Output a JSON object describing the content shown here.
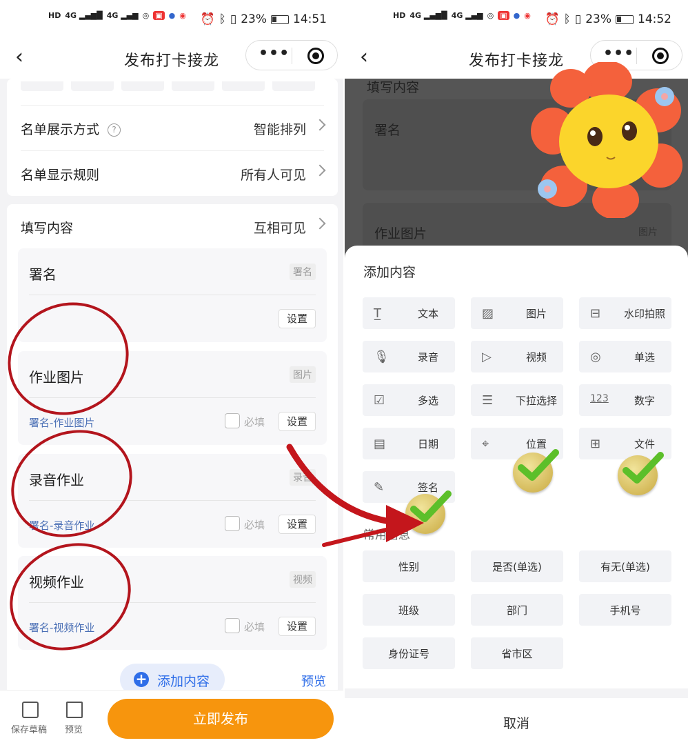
{
  "status_left": {
    "time": "14:51",
    "battery": "23%"
  },
  "status_right": {
    "time": "14:52",
    "battery": "23%"
  },
  "nav": {
    "title": "发布打卡接龙",
    "more": "•••"
  },
  "settings": {
    "display_mode": {
      "label": "名单展示方式",
      "value": "智能排列"
    },
    "display_rule": {
      "label": "名单显示规则",
      "value": "所有人可见"
    }
  },
  "fill": {
    "label": "填写内容",
    "value": "互相可见"
  },
  "items": [
    {
      "title": "署名",
      "tag": "署名",
      "setting": "设置"
    },
    {
      "title": "作业图片",
      "tag": "图片",
      "sub": "署名-作业图片",
      "required": "必填",
      "setting": "设置"
    },
    {
      "title": "录音作业",
      "tag": "录音",
      "sub": "署名-录音作业",
      "required": "必填",
      "setting": "设置"
    },
    {
      "title": "视频作业",
      "tag": "视频",
      "sub": "署名-视频作业",
      "required": "必填",
      "setting": "设置"
    }
  ],
  "add_content": "添加内容",
  "preview": "预览",
  "bottom": {
    "save_draft": "保存草稿",
    "preview": "预览",
    "publish": "立即发布"
  },
  "overlay": {
    "fill_label": "填写内容",
    "item1": "署名",
    "item2": "作业图片",
    "item2_tag": "图片"
  },
  "sheet": {
    "title": "添加内容",
    "tiles": [
      "文本",
      "图片",
      "水印拍照",
      "录音",
      "视频",
      "单选",
      "多选",
      "下拉选择",
      "数字",
      "日期",
      "位置",
      "文件",
      "签名"
    ],
    "number_icon": "123",
    "common_title": "常用信息",
    "common": [
      "性别",
      "是否(单选)",
      "有无(单选)",
      "班级",
      "部门",
      "手机号",
      "身份证号",
      "省市区"
    ],
    "cancel": "取消"
  },
  "icons": [
    "back-icon",
    "more-icon",
    "target-icon",
    "help-icon",
    "chevron-right-icon",
    "plus-icon",
    "save-icon",
    "preview-icon",
    "text-icon",
    "image-icon",
    "watermark-camera-icon",
    "mic-icon",
    "video-icon",
    "radio-icon",
    "checkbox-icon",
    "dropdown-icon",
    "number-icon",
    "calendar-icon",
    "location-icon",
    "file-icon",
    "signature-icon"
  ],
  "colors": {
    "accent": "#2f6ee8",
    "publish": "#f7950d",
    "annotation": "#b3151d"
  }
}
